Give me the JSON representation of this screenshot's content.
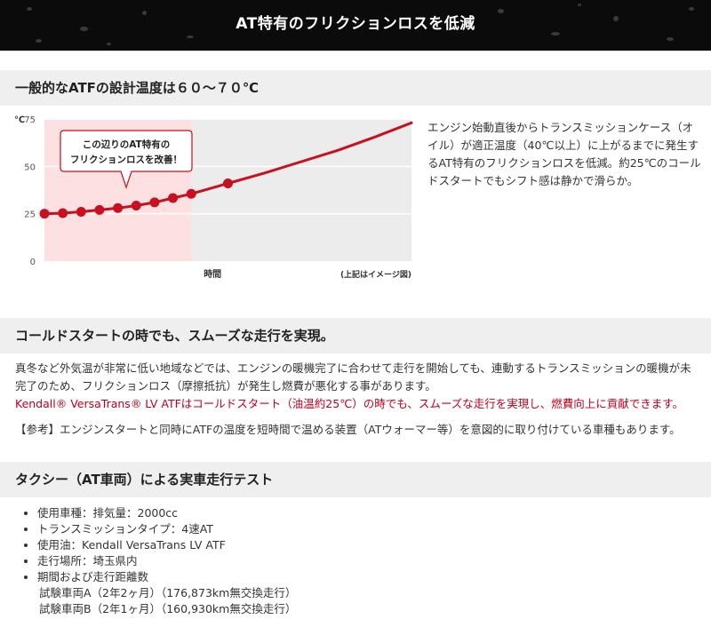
{
  "banner": {
    "title": "AT特有のフリクションロスを低減"
  },
  "section1": {
    "heading": "一般的なATFの設計温度は６０～７０℃",
    "callout": [
      "この辺りのAT特有の",
      "フリクションロスを改善！"
    ],
    "description": "エンジン始動直後からトランスミッションケース（オイル）が適正温度（40℃以上）に上がるまでに発生するAT特有のフリクションロスを低減。約25℃のコールドスタートでもシフト感は静かで滑らか。"
  },
  "chart_data": {
    "type": "line",
    "title": "",
    "ylabel": "℃",
    "xlabel": "時間",
    "note": "(上記はイメージ図)",
    "yticks": [
      0,
      25,
      50,
      75
    ],
    "ylim": [
      0,
      75
    ],
    "xlim": [
      0,
      10
    ],
    "shaded_region": [
      0,
      4.0
    ],
    "series": [
      {
        "color": "#c8101e",
        "x": [
          0,
          0.5,
          1,
          1.5,
          2,
          2.5,
          3,
          3.5,
          4,
          5,
          6,
          7,
          8,
          9,
          10
        ],
        "y": [
          25,
          25.3,
          26,
          27,
          28,
          29.3,
          31,
          33.3,
          35.5,
          41,
          46.5,
          52.5,
          58.5,
          65.5,
          73
        ],
        "marker_count": 10
      }
    ],
    "colors": {
      "line": "#c8101e",
      "shade": "#fde0e2",
      "plot_bg": "#ececec"
    }
  },
  "section2": {
    "heading": "コールドスタートの時でも、スムーズな走行を実現。",
    "paragraph": "真冬など外気温が非常に低い地域などでは、エンジンの暖機完了に合わせて走行を開始しても、連動するトランスミッションの暖機が未完了のため、フリクションロス（摩擦抵抗）が発生し燃費が悪化する事があります。",
    "highlight": "Kendall® VersaTrans® LV ATFはコールドスタート（油温約25℃）の時でも、スムーズな走行を実現し、燃費向上に貢献できます。",
    "note": "【参考】エンジンスタートと同時にATFの温度を短時間で温める装置（ATウォーマー等）を意図的に取り付けている車種もあります。"
  },
  "section3": {
    "heading": "タクシー（AT車両）による実車走行テスト",
    "items": [
      "使用車種：排気量：2000cc",
      "トランスミッションタイプ：4速AT",
      "使用油：Kendall VersaTrans LV ATF",
      "走行場所：埼玉県内",
      "期間および走行距離数"
    ],
    "subitems": [
      "試験車両A（2年2ヶ月）（176,873km無交換走行）",
      "試験車両B（2年1ヶ月）（160,930km無交換走行）"
    ]
  }
}
